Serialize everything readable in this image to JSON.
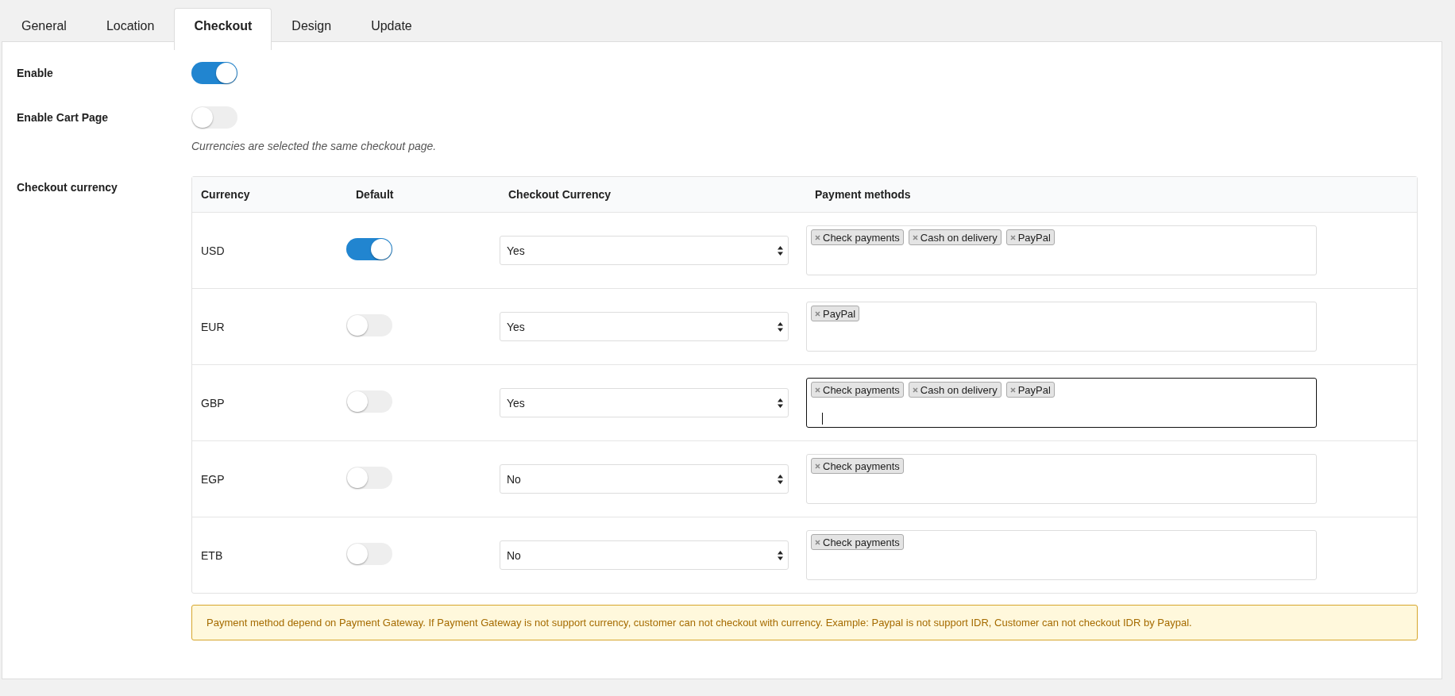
{
  "tabs": [
    {
      "label": "General",
      "selected": false
    },
    {
      "label": "Location",
      "selected": false
    },
    {
      "label": "Checkout",
      "selected": true
    },
    {
      "label": "Design",
      "selected": false
    },
    {
      "label": "Update",
      "selected": false
    }
  ],
  "settings": [
    {
      "label": "Enable",
      "on": true
    },
    {
      "label": "Enable Cart Page",
      "on": false,
      "help": "Currencies are selected the same checkout page."
    }
  ],
  "checkout_currency": {
    "label": "Checkout currency",
    "columns": [
      "Currency",
      "Default",
      "Checkout Currency",
      "Payment methods"
    ],
    "rows": [
      {
        "currency": "USD",
        "default": true,
        "checkout_currency": "Yes",
        "payment_methods": [
          "Check payments",
          "Cash on delivery",
          "PayPal"
        ],
        "focused": false
      },
      {
        "currency": "EUR",
        "default": false,
        "checkout_currency": "Yes",
        "payment_methods": [
          "PayPal"
        ],
        "focused": false
      },
      {
        "currency": "GBP",
        "default": false,
        "checkout_currency": "Yes",
        "payment_methods": [
          "Check payments",
          "Cash on delivery",
          "PayPal"
        ],
        "focused": true
      },
      {
        "currency": "EGP",
        "default": false,
        "checkout_currency": "No",
        "payment_methods": [
          "Check payments"
        ],
        "focused": false
      },
      {
        "currency": "ETB",
        "default": false,
        "checkout_currency": "No",
        "payment_methods": [
          "Check payments"
        ],
        "focused": false
      }
    ],
    "notice": "Payment method depend on Payment Gateway. If Payment Gateway is not support currency, customer can not checkout with currency. Example: Paypal is not support IDR, Customer can not checkout IDR by Paypal."
  }
}
